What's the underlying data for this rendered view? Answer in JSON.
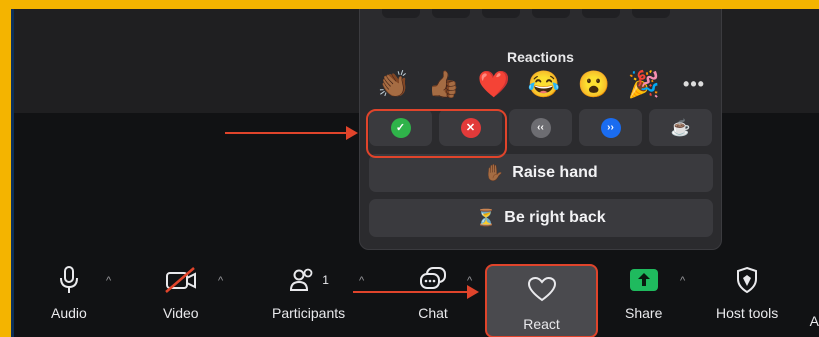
{
  "reactions": {
    "title": "Reactions",
    "emojis": [
      "👏🏾",
      "👍🏾",
      "❤️",
      "😂",
      "😮",
      "🎉"
    ],
    "more_label": "•••",
    "status_buttons": [
      {
        "icon": "checkmark-icon",
        "glyph": "✓",
        "color": "#2fb34a"
      },
      {
        "icon": "x-icon",
        "glyph": "✕",
        "color": "#e23a3a"
      },
      {
        "icon": "slow-down-icon",
        "glyph": "‹‹",
        "color": "#6d6d72"
      },
      {
        "icon": "speed-up-icon",
        "glyph": "››",
        "color": "#1a6cf0"
      },
      {
        "icon": "coffee-icon",
        "glyph": "☕"
      }
    ],
    "raise_hand": {
      "emoji": "✋🏾",
      "label": "Raise hand"
    },
    "be_right_back": {
      "emoji": "⏳",
      "label": "Be right back"
    }
  },
  "toolbar": {
    "audio": "Audio",
    "video": "Video",
    "participants": "Participants",
    "participants_count": "1",
    "chat": "Chat",
    "react": "React",
    "share": "Share",
    "host_tools": "Host tools",
    "cut_off": "A"
  },
  "caret": "^"
}
